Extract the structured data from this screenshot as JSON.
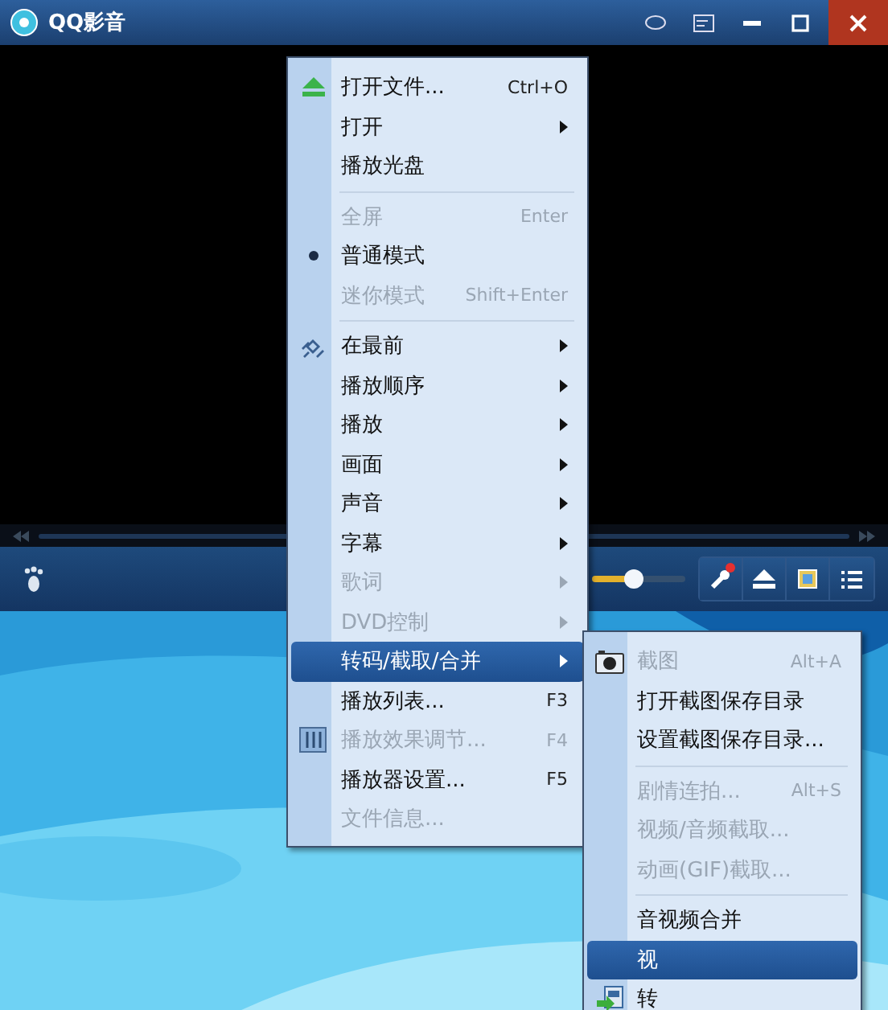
{
  "window": {
    "title": "QQ影音"
  },
  "controls": {
    "volume": {
      "level": 0.45
    },
    "settings_alert": true
  },
  "menu": {
    "items": [
      {
        "kind": "item",
        "label": "打开文件...",
        "shortcut": "Ctrl+O",
        "disabled": false,
        "checked": false,
        "submenu": false,
        "selected": false
      },
      {
        "kind": "item",
        "label": "打开",
        "disabled": false,
        "checked": false,
        "submenu": true,
        "selected": false
      },
      {
        "kind": "item",
        "label": "播放光盘",
        "disabled": false,
        "checked": false,
        "submenu": false,
        "selected": false
      },
      {
        "kind": "separator"
      },
      {
        "kind": "item",
        "label": "全屏",
        "shortcut": "Enter",
        "disabled": true,
        "checked": false,
        "submenu": false,
        "selected": false
      },
      {
        "kind": "item",
        "label": "普通模式",
        "disabled": false,
        "checked": true,
        "submenu": false,
        "selected": false
      },
      {
        "kind": "item",
        "label": "迷你模式",
        "shortcut": "Shift+Enter",
        "disabled": true,
        "checked": false,
        "submenu": false,
        "selected": false
      },
      {
        "kind": "separator"
      },
      {
        "kind": "item",
        "label": "在最前",
        "disabled": false,
        "checked": false,
        "submenu": true,
        "selected": false
      },
      {
        "kind": "item",
        "label": "播放顺序",
        "disabled": false,
        "checked": false,
        "submenu": true,
        "selected": false
      },
      {
        "kind": "item",
        "label": "播放",
        "disabled": false,
        "checked": false,
        "submenu": true,
        "selected": false
      },
      {
        "kind": "item",
        "label": "画面",
        "disabled": false,
        "checked": false,
        "submenu": true,
        "selected": false
      },
      {
        "kind": "item",
        "label": "声音",
        "disabled": false,
        "checked": false,
        "submenu": true,
        "selected": false
      },
      {
        "kind": "item",
        "label": "字幕",
        "disabled": false,
        "checked": false,
        "submenu": true,
        "selected": false
      },
      {
        "kind": "item",
        "label": "歌词",
        "disabled": true,
        "checked": false,
        "submenu": true,
        "selected": false
      },
      {
        "kind": "item",
        "label": "DVD控制",
        "disabled": true,
        "checked": false,
        "submenu": true,
        "selected": false
      },
      {
        "kind": "item",
        "label": "转码/截取/合并",
        "disabled": false,
        "checked": false,
        "submenu": true,
        "selected": true
      },
      {
        "kind": "item",
        "label": "播放列表...",
        "shortcut": "F3",
        "disabled": false,
        "checked": false,
        "submenu": false,
        "selected": false
      },
      {
        "kind": "item",
        "label": "播放效果调节...",
        "shortcut": "F4",
        "disabled": true,
        "checked": false,
        "submenu": false,
        "selected": false
      },
      {
        "kind": "item",
        "label": "播放器设置...",
        "shortcut": "F5",
        "disabled": false,
        "checked": false,
        "submenu": false,
        "selected": false
      },
      {
        "kind": "item",
        "label": "文件信息...",
        "disabled": true,
        "checked": false,
        "submenu": false,
        "selected": false
      }
    ]
  },
  "submenu": {
    "items": [
      {
        "kind": "item",
        "label": "截图",
        "shortcut": "Alt+A",
        "disabled": true,
        "selected": false
      },
      {
        "kind": "item",
        "label": "打开截图保存目录",
        "disabled": false,
        "selected": false
      },
      {
        "kind": "item",
        "label": "设置截图保存目录...",
        "disabled": false,
        "selected": false
      },
      {
        "kind": "separator"
      },
      {
        "kind": "item",
        "label": "剧情连拍...",
        "shortcut": "Alt+S",
        "disabled": true,
        "selected": false
      },
      {
        "kind": "item",
        "label": "视频/音频截取...",
        "disabled": true,
        "selected": false
      },
      {
        "kind": "item",
        "label": "动画(GIF)截取...",
        "disabled": true,
        "selected": false
      },
      {
        "kind": "separator"
      },
      {
        "kind": "item",
        "label": "音视频合并",
        "disabled": false,
        "selected": false
      },
      {
        "kind": "item",
        "label": "视",
        "disabled": false,
        "selected": true
      },
      {
        "kind": "item",
        "label": "转",
        "disabled": false,
        "selected": false
      }
    ]
  }
}
